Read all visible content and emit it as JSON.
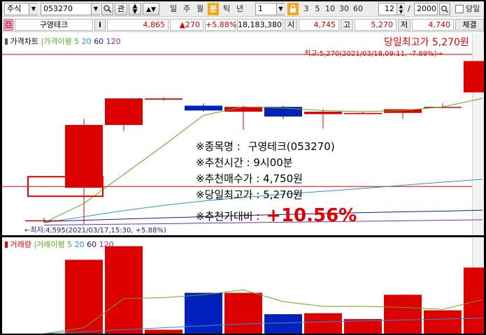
{
  "toolbar": {
    "market": "주식",
    "code": "053270",
    "search_icon": "magnifier-icon",
    "watch_label": "관",
    "periods": [
      "일",
      "주",
      "월",
      "분",
      "틱",
      "년"
    ],
    "active_period": "분",
    "interval_value": "1",
    "lock_icon": "lock-icon",
    "quick_intervals": [
      "3",
      "5",
      "10",
      "30",
      "60"
    ],
    "count_value": "12",
    "bars_value": "2000",
    "checkbox_label": "당일"
  },
  "quote": {
    "name": "구영테크",
    "info_label": "i",
    "price": "4,865",
    "change": "▲270",
    "change_pct": "+5.88%",
    "volume": "18,183,380",
    "open_label": "시",
    "open": "4,745",
    "high_label": "고",
    "high": "5,270",
    "low_label": "저",
    "low": "4,740",
    "trade_label": "체결"
  },
  "price_panel": {
    "legend_title": "가격차트",
    "ma_label": "가격이평",
    "ma_periods": [
      "5",
      "20",
      "60",
      "120"
    ],
    "day_high_label": "당일최고가 5,270원",
    "high_annotation": "최고:5,270(2021/03/18,09:11, -7.69%)→",
    "low_annotation": "←최저:4,595(2021/03/17,15:30, +5.88%)"
  },
  "recommendation": {
    "name_label": "※종목명 :",
    "name_value": "구영테크(053270)",
    "time_label": "※추천시간 :",
    "time_value": "9시00분",
    "buy_label": "※추천매수가 :",
    "buy_value": "4,750원",
    "high_label": "※당일최고가 :",
    "high_value": "5,270원",
    "ratio_label": "※추천가대비 :",
    "ratio_value": "+10.56%"
  },
  "volume_panel": {
    "legend_title": "거래량",
    "ma_label": "거래이평",
    "ma_periods": [
      "5",
      "20",
      "60",
      "120"
    ]
  },
  "colors": {
    "up": "#dd0000",
    "down": "#0022bb",
    "ma5": "#5aaa1e",
    "ma20": "#2a8fdc",
    "ma60": "#1a1a9a",
    "ma120": "#8a2a9a",
    "accent": "#f5a623"
  },
  "chart_data": {
    "type": "candlestick",
    "candles": [
      {
        "open": 4610,
        "close": 4610,
        "high": 4620,
        "low": 4600
      },
      {
        "open": 4745,
        "close": 5005,
        "high": 5030,
        "low": 4595
      },
      {
        "open": 5005,
        "close": 5115,
        "high": 5115,
        "low": 4980
      },
      {
        "open": 5110,
        "close": 5115,
        "high": 5120,
        "low": 5105
      },
      {
        "open": 5085,
        "close": 5065,
        "high": 5095,
        "low": 5060
      },
      {
        "open": 5060,
        "close": 5080,
        "high": 5085,
        "low": 4985
      },
      {
        "open": 5080,
        "close": 5040,
        "high": 5085,
        "low": 5030
      },
      {
        "open": 5050,
        "close": 5060,
        "high": 5070,
        "low": 4990
      },
      {
        "open": 5050,
        "close": 5055,
        "high": 5060,
        "low": 5050
      },
      {
        "open": 5055,
        "close": 5070,
        "high": 5070,
        "low": 5030
      },
      {
        "open": 5080,
        "close": 5080,
        "high": 5095,
        "low": 5075
      },
      {
        "open": 5140,
        "close": 5270,
        "high": 5270,
        "low": 5140
      }
    ],
    "volumes": [
      0,
      760,
      900,
      40,
      420,
      420,
      200,
      210,
      150,
      400,
      240,
      680
    ],
    "volume_ma5": [
      0,
      60,
      360,
      370,
      400,
      450,
      330,
      280,
      280,
      270,
      250,
      350
    ],
    "volume_ma20": [
      0,
      20,
      40,
      60,
      80,
      100,
      110,
      120,
      130,
      140,
      150,
      160
    ],
    "price_ma5": [
      4600,
      4680,
      4800,
      4920,
      5045,
      5080,
      5075,
      5065,
      5060,
      5065,
      5080,
      5115
    ],
    "price_ma20": [
      4600,
      4625,
      4650,
      4672,
      4690,
      4705,
      4718,
      4730,
      4742,
      4755,
      4768,
      4780
    ],
    "price_ma60": [
      4605,
      4610,
      4615,
      4620,
      4625,
      4630,
      4634,
      4638,
      4642,
      4645,
      4648,
      4652
    ],
    "price_ma120": [
      4590,
      4592,
      4594,
      4596,
      4598,
      4600,
      4602,
      4604,
      4606,
      4608,
      4610,
      4612
    ],
    "reference_price": 4750,
    "day_high": 5270
  }
}
